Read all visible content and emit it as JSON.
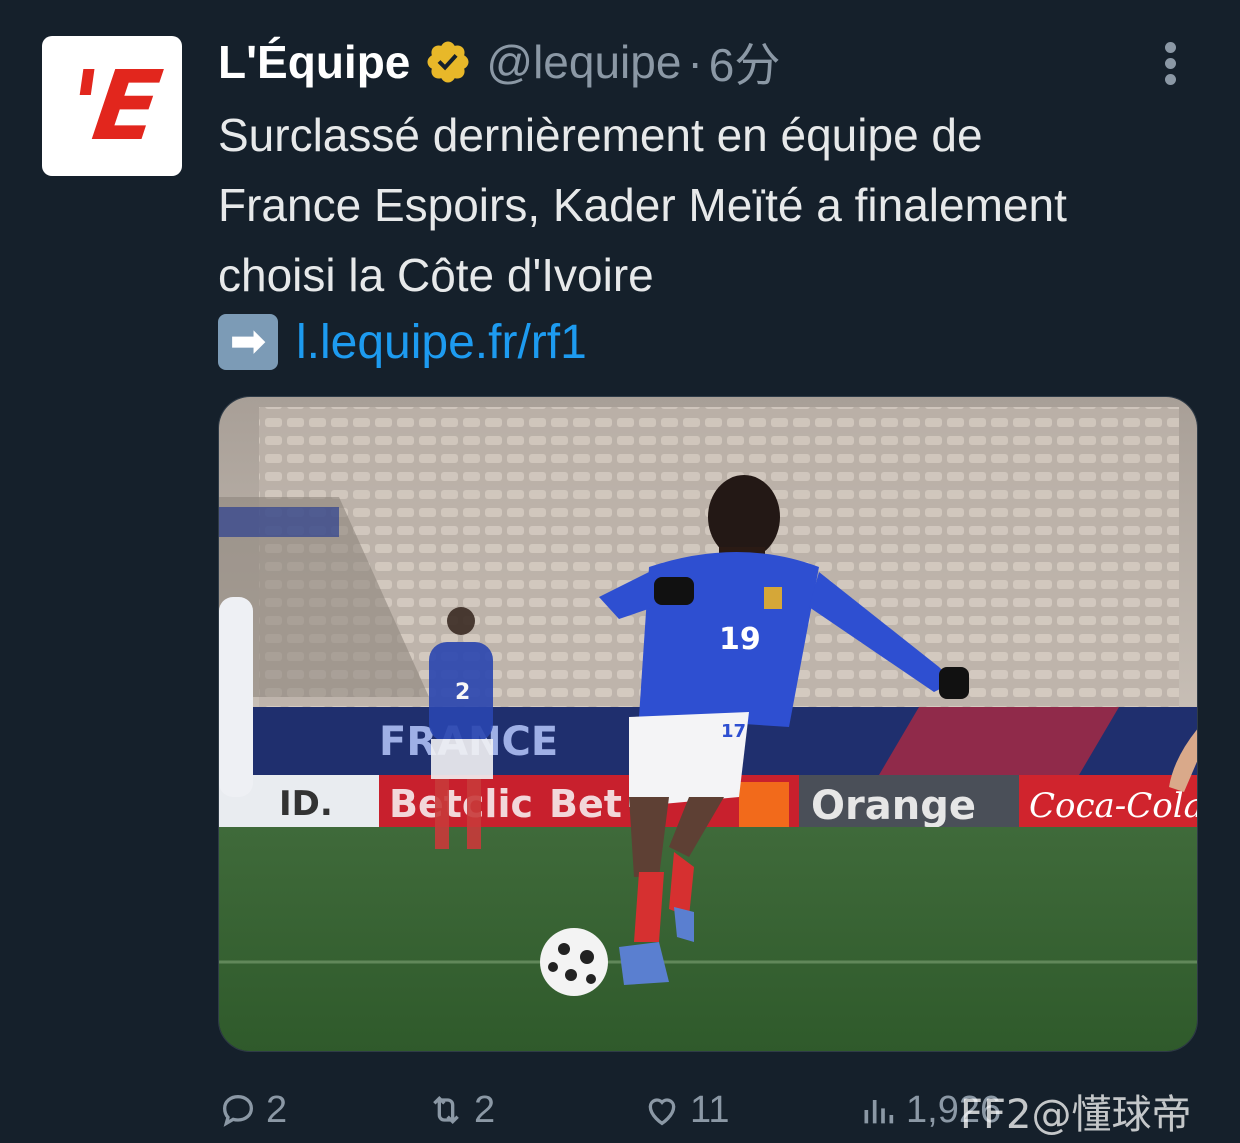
{
  "tweet": {
    "author_name": "L'Équipe",
    "author_handle": "@lequipe",
    "separator": "·",
    "time_ago": "6分",
    "avatar_text": "'E",
    "text": "Surclassé dernièrement en équipe de\nFrance Espoirs, Kader Meïté a finalement\nchoisi la Côte d'Ivoire",
    "link_emoji": "➡",
    "link_text": "l.lequipe.fr/rf1"
  },
  "media": {
    "player_number": "19",
    "shorts_number": "17",
    "bg_player_number": "2",
    "ad_boards": [
      "FRANCE",
      "ID.",
      "Betclic",
      "Bet",
      "Orange",
      "Coca-Cola"
    ]
  },
  "actions": {
    "replies": "2",
    "reposts": "2",
    "likes": "11",
    "views": "1,926"
  },
  "watermark": "FF2@懂球帝",
  "colors": {
    "background": "#15202b",
    "link": "#1d9bf0",
    "muted": "#8b98a5",
    "verified_gold": "#e8b829",
    "brand_red": "#e2261d"
  }
}
